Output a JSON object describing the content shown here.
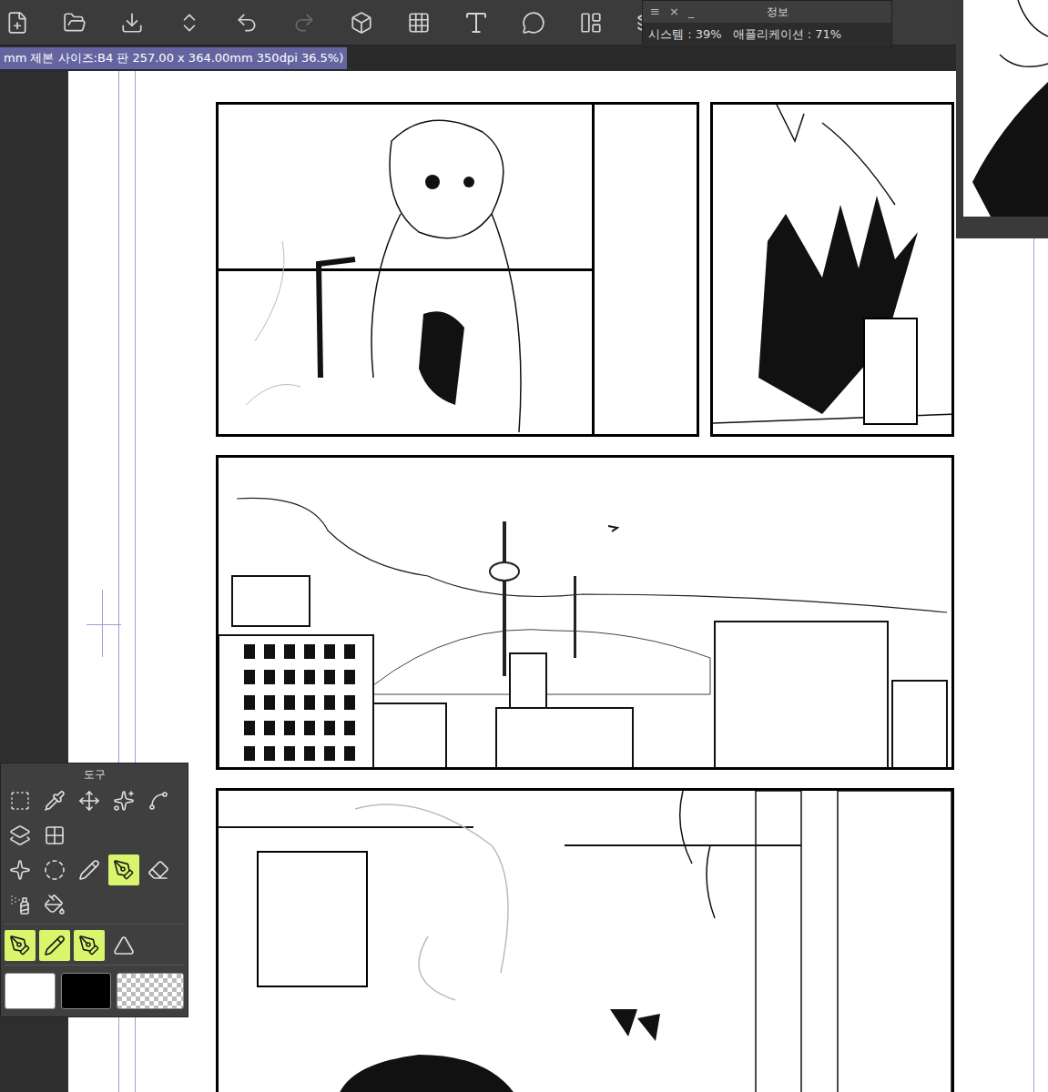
{
  "toolbar": {
    "buttons": [
      {
        "disabled": false
      },
      {
        "disabled": false
      },
      {
        "disabled": false
      },
      {
        "disabled": false
      },
      {
        "disabled": false
      },
      {
        "disabled": true
      },
      {
        "disabled": false
      },
      {
        "disabled": false
      },
      {
        "disabled": false
      },
      {
        "disabled": false
      },
      {
        "disabled": false
      },
      {
        "disabled": false
      }
    ]
  },
  "info_panel": {
    "controls": [
      "≡",
      "×",
      "_"
    ],
    "title": "정보",
    "system": "시스템 : 39%",
    "application": "애플리케이션 : 71%"
  },
  "document_tab": {
    "label": "mm 제본 사이즈:B4 판 257.00 x 364.00mm 350dpi 36.5%)"
  },
  "tool_palette": {
    "title": "도구",
    "rows": [
      [
        {
          "selected": false
        },
        {
          "selected": false
        },
        {
          "selected": false
        },
        {
          "selected": false
        },
        {
          "selected": false
        }
      ],
      [
        {
          "selected": false
        },
        {
          "selected": false
        }
      ],
      [
        {
          "selected": false
        },
        {
          "selected": false
        },
        {
          "selected": false
        },
        {
          "selected": true
        },
        {
          "selected": false
        }
      ],
      [
        {
          "selected": false
        },
        {
          "selected": false
        }
      ],
      [
        {
          "selected": true
        },
        {
          "selected": true
        },
        {
          "selected": true
        },
        {
          "selected": false
        }
      ]
    ],
    "colors": [
      {
        "kind": "solid",
        "color": "#ffffff"
      },
      {
        "kind": "solid",
        "color": "#000000"
      },
      {
        "kind": "transparent",
        "color": "#ffffff"
      }
    ]
  }
}
